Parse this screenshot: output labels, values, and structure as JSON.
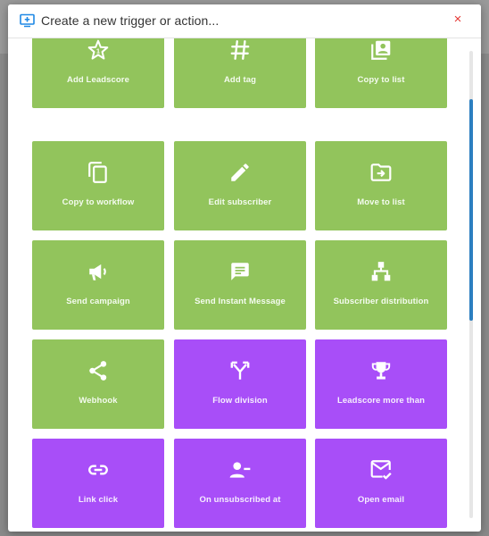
{
  "modal": {
    "title": "Create a new trigger or action...",
    "close_symbol": "×"
  },
  "tiles": [
    {
      "label": "Add Leadscore",
      "icon": "star-icon",
      "color": "#92c45c"
    },
    {
      "label": "Add tag",
      "icon": "hashtag-icon",
      "color": "#92c45c"
    },
    {
      "label": "Copy to list",
      "icon": "contact-list-icon",
      "color": "#92c45c"
    },
    {
      "label": "Copy to workflow",
      "icon": "copy-icon",
      "color": "#92c45c"
    },
    {
      "label": "Edit subscriber",
      "icon": "pencil-icon",
      "color": "#92c45c"
    },
    {
      "label": "Move to list",
      "icon": "folder-move-icon",
      "color": "#92c45c"
    },
    {
      "label": "Send campaign",
      "icon": "megaphone-icon",
      "color": "#92c45c"
    },
    {
      "label": "Send Instant Message",
      "icon": "message-icon",
      "color": "#92c45c"
    },
    {
      "label": "Subscriber distribution",
      "icon": "hierarchy-icon",
      "color": "#92c45c"
    },
    {
      "label": "Webhook",
      "icon": "share-icon",
      "color": "#92c45c"
    },
    {
      "label": "Flow division",
      "icon": "merge-icon",
      "color": "#a84ef8"
    },
    {
      "label": "Leadscore more than",
      "icon": "trophy-icon",
      "color": "#a84ef8"
    },
    {
      "label": "Link click",
      "icon": "link-icon",
      "color": "#a84ef8"
    },
    {
      "label": "On unsubscribed at",
      "icon": "person-remove-icon",
      "color": "#a84ef8"
    },
    {
      "label": "Open email",
      "icon": "mark-email-read-icon",
      "color": "#a84ef8"
    }
  ],
  "colors": {
    "action_tile": "#92c45c",
    "trigger_tile": "#a84ef8",
    "scrollbar": "#2c7fc0",
    "close": "#e53935"
  }
}
